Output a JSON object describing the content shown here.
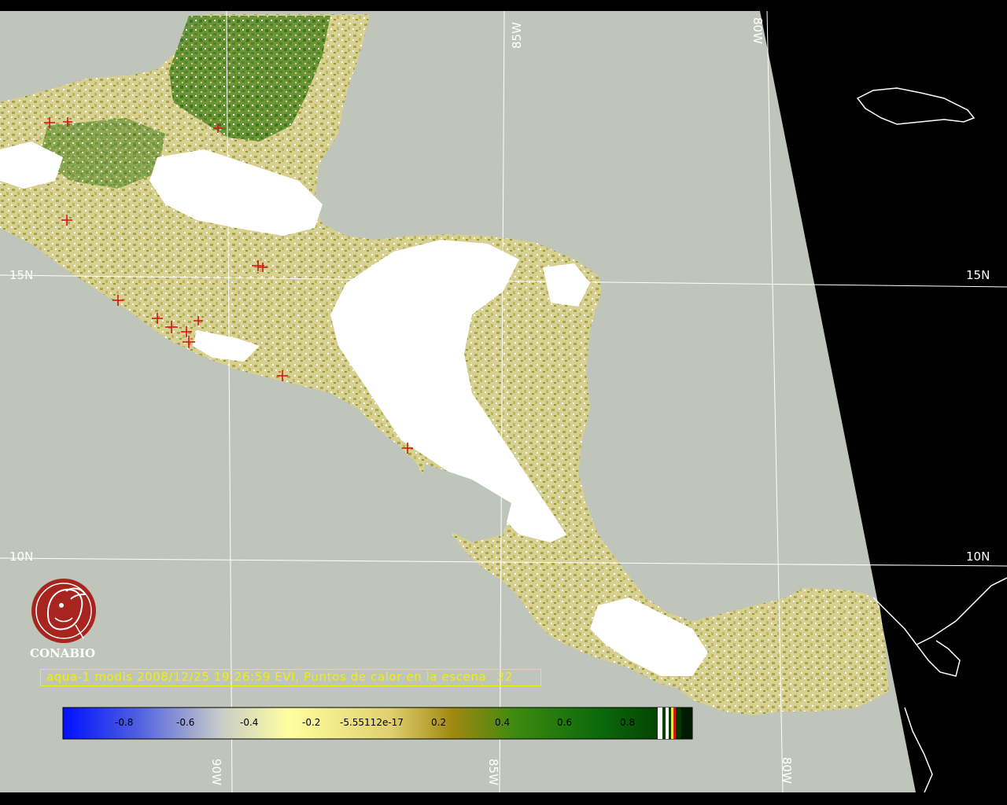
{
  "graticule": {
    "top_lon_85": "85W",
    "top_lon_80": "80W",
    "bottom_lon_90": "90W",
    "bottom_lon_85": "85W",
    "bottom_lon_80": "80W",
    "left_lat_15": "15N",
    "right_lat_15": "15N",
    "left_lat_10": "10N",
    "right_lat_10": "10N"
  },
  "logo": {
    "name": "CONABIO"
  },
  "title": {
    "prefix": "aqua-1 modis 2008/12/25 19:26:59 EVI, Puntos de calor en la escena",
    "count": "22"
  },
  "colorbar": {
    "ticks": [
      "-0.8",
      "-0.6",
      "-0.4",
      "-0.2",
      "-5.55112e-17",
      "0.2",
      "0.4",
      "0.6",
      "0.8"
    ],
    "gradient_colors": [
      "#0010ff",
      "#ffffa0",
      "#a08810",
      "#006400",
      "#003000"
    ]
  },
  "colors": {
    "ocean": "#c0c5bc",
    "cloud": "#ffffff",
    "vegetation_low": "#e8e0a0",
    "vegetation_mid": "#a8a450",
    "vegetation_high": "#2e7a0c",
    "hotspot": "#d01818",
    "title": "#f2ef00",
    "logo": "#a8241e",
    "no_data": "#000000"
  },
  "icons": {
    "logo": "conabio-macaw-logo-icon",
    "hotspot": "red-cross-marker-icon"
  }
}
